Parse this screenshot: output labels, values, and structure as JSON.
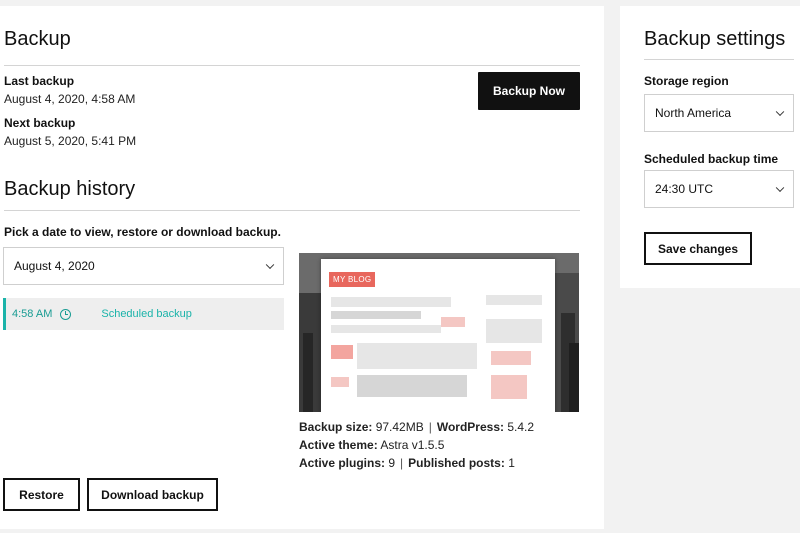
{
  "backup": {
    "title": "Backup",
    "last_backup_label": "Last backup",
    "last_backup_value": "August 4, 2020, 4:58 AM",
    "next_backup_label": "Next backup",
    "next_backup_value": "August 5, 2020, 5:41 PM",
    "backup_now_label": "Backup Now"
  },
  "history": {
    "title": "Backup history",
    "instruction": "Pick a date to view, restore or download backup.",
    "selected_date": "August 4, 2020",
    "items": [
      {
        "time": "4:58 AM",
        "type": "Scheduled backup"
      }
    ],
    "preview_badge": "MY BLOG",
    "details": {
      "backup_size_label": "Backup size:",
      "backup_size": "97.42MB",
      "wordpress_label": "WordPress:",
      "wordpress": "5.4.2",
      "theme_label": "Active theme:",
      "theme": "Astra v1.5.5",
      "plugins_label": "Active plugins:",
      "plugins": "9",
      "posts_label": "Published posts:",
      "posts": "1"
    },
    "restore_label": "Restore",
    "download_label": "Download backup"
  },
  "settings": {
    "title": "Backup settings",
    "region_label": "Storage region",
    "region_value": "North America",
    "schedule_label": "Scheduled backup time",
    "schedule_value": "24:30 UTC",
    "save_label": "Save changes"
  },
  "colors": {
    "accent": "#1bb3a9",
    "badge": "#e8675d",
    "primary_button": "#111111"
  }
}
